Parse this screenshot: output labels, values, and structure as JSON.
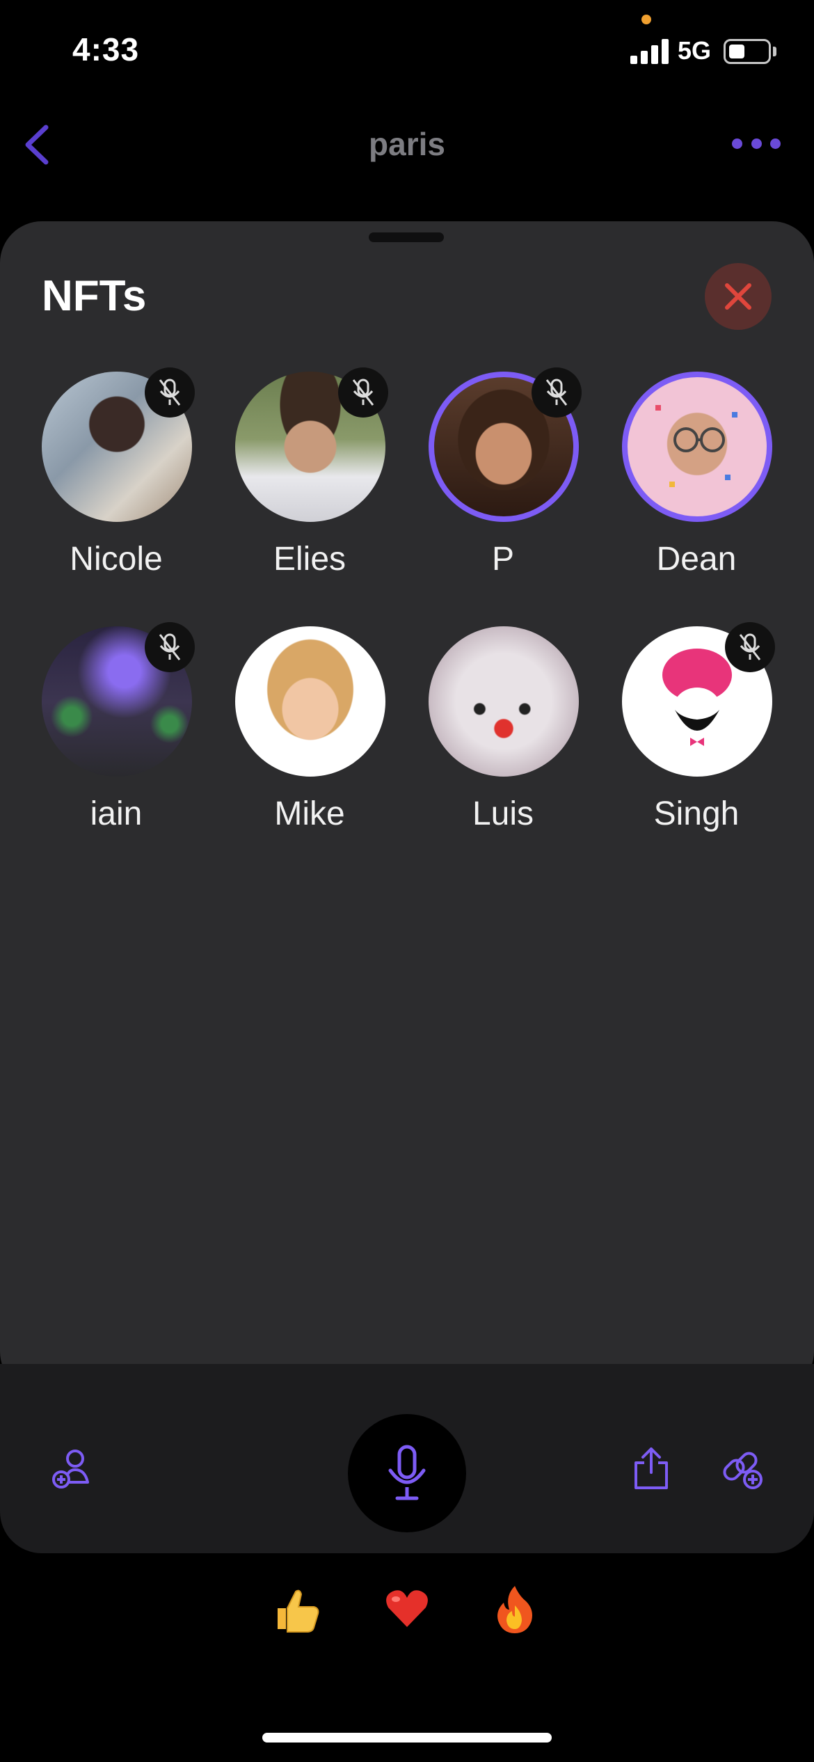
{
  "status_bar": {
    "time": "4:33",
    "network": "5G"
  },
  "header": {
    "title": "paris",
    "back_icon": "chevron-left-icon",
    "more_icon": "ellipsis-icon",
    "accent": "#6a4ad8"
  },
  "sheet": {
    "title": "NFTs",
    "close_icon": "close-icon"
  },
  "members": [
    {
      "name": "Nicole",
      "muted": true,
      "speaking": false
    },
    {
      "name": "Elies",
      "muted": true,
      "speaking": false
    },
    {
      "name": "P",
      "muted": true,
      "speaking": true
    },
    {
      "name": "Dean",
      "muted": false,
      "speaking": true
    },
    {
      "name": "iain",
      "muted": true,
      "speaking": false
    },
    {
      "name": "Mike",
      "muted": false,
      "speaking": false
    },
    {
      "name": "Luis",
      "muted": false,
      "speaking": false
    },
    {
      "name": "Singh",
      "muted": true,
      "speaking": false
    }
  ],
  "controls": {
    "left_icon": "add-person-icon",
    "center_icon": "microphone-icon",
    "share_icon": "share-icon",
    "link_icon": "add-link-icon"
  },
  "reactions": [
    "👍",
    "❤️",
    "🔥"
  ],
  "colors": {
    "accent": "#7d5cf5",
    "sheet": "#2c2c2e",
    "close": "#e0463c"
  }
}
